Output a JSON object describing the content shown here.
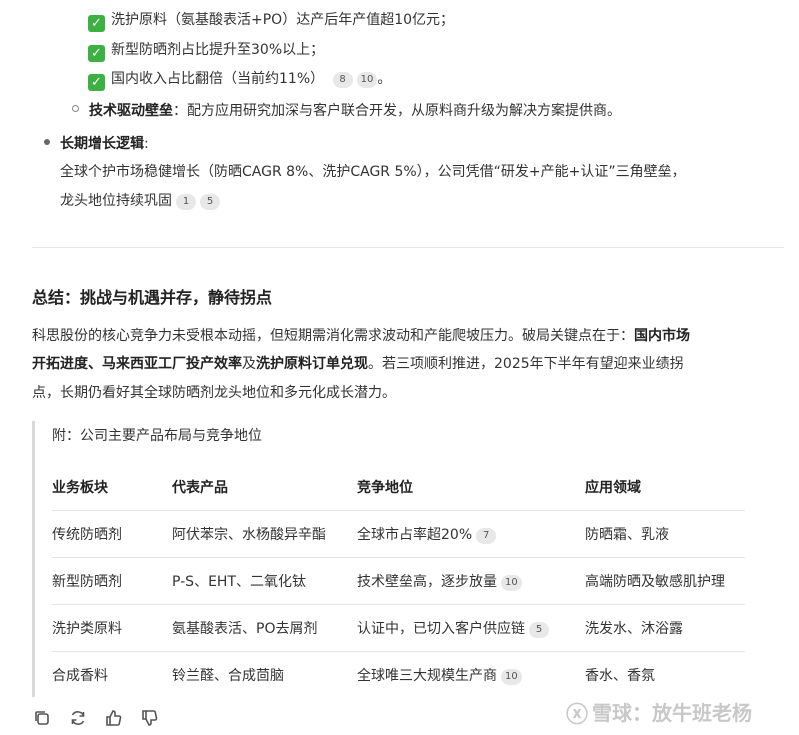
{
  "checks": [
    {
      "text": "洗护原料（氨基酸表活+PO）达产后年产值超10亿元；",
      "cites": []
    },
    {
      "text": "新型防晒剂占比提升至30%以上；",
      "cites": []
    },
    {
      "text": "国内收入占比翻倍（当前约11%）",
      "cites": [
        "8",
        "10"
      ],
      "suffix": "。"
    }
  ],
  "tech": {
    "label": "技术驱动壁垒",
    "colon": "：",
    "text": "配方应用研究加深与客户联合开发，从原料商升级为解决方案提供商。"
  },
  "longterm": {
    "label": "长期增长逻辑",
    "colon": ":",
    "line1": "全球个护市场稳健增长（防晒CAGR 8%、洗护CAGR 5%），公司凭借“研发+产能+认证”三角壁垒，",
    "line2": "龙头地位持续巩固",
    "cites": [
      "1",
      "5"
    ]
  },
  "summary": {
    "heading": "总结：挑战与机遇并存，静待拐点",
    "p_line1_plain": "科思股份的核心竞争力未受根本动摇，但短期需消化需求波动和产能爬坡压力。破局关键点在于：",
    "p_line1_bold": "国内市场",
    "p_line2_bold1": "开拓进度、马来西亚工厂投产效率",
    "p_line2_plain1": "及",
    "p_line2_bold2": "洗护原料订单兑现",
    "p_line2_plain2": "。若三项顺利推进，2025年下半年有望迎来业绩拐",
    "p_line3": "点，长期仍看好其全球防晒剂龙头地位和多元化成长潜力。"
  },
  "appendix": {
    "title": "附：公司主要产品布局与竞争地位",
    "headers": [
      "业务板块",
      "代表产品",
      "竞争地位",
      "应用领域"
    ],
    "rows": [
      {
        "segment": "传统防晒剂",
        "products": "阿伏苯宗、水杨酸异辛酯",
        "position": "全球市占率超20%",
        "cite": "7",
        "application": "防晒霜、乳液"
      },
      {
        "segment": "新型防晒剂",
        "products": "P-S、EHT、二氧化钛",
        "position": "技术壁垒高，逐步放量",
        "cite": "10",
        "application": "高端防晒及敏感肌护理"
      },
      {
        "segment": "洗护类原料",
        "products": "氨基酸表活、PO去屑剂",
        "position": "认证中，已切入客户供应链",
        "cite": "5",
        "application": "洗发水、沐浴露"
      },
      {
        "segment": "合成香料",
        "products": "铃兰醛、合成茴脑",
        "position": "全球唯三大规模生产商",
        "cite": "10",
        "application": "香水、香氛"
      }
    ]
  },
  "toolbar": {
    "icons": [
      "copy-icon",
      "refresh-icon",
      "thumbs-up-icon",
      "thumbs-down-icon"
    ]
  },
  "watermark": {
    "text": "雪球：放牛班老杨"
  },
  "colors": {
    "check_green": "#3cb043",
    "divider": "#e5e5e5",
    "text": "#333333"
  }
}
